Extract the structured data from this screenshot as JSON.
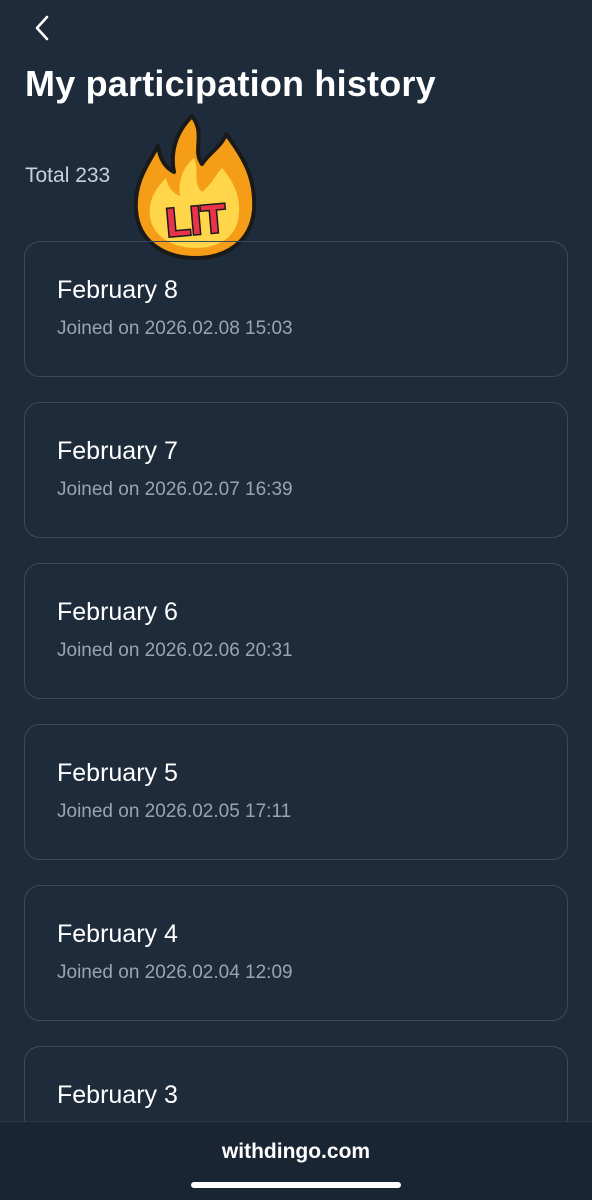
{
  "header": {
    "back_icon": "chevron-left-icon",
    "title": "My participation history"
  },
  "summary": {
    "total_text": "Total 233"
  },
  "sticker": {
    "text": "LIT",
    "icon": "fire-icon",
    "colors": {
      "flame_outer": "#f59d16",
      "flame_inner": "#ffd54a",
      "text_fill": "#e8334a",
      "outline": "#1a1a1a"
    }
  },
  "history": [
    {
      "date": "February 8",
      "joined": "Joined on 2026.02.08 15:03"
    },
    {
      "date": "February 7",
      "joined": "Joined on 2026.02.07 16:39"
    },
    {
      "date": "February 6",
      "joined": "Joined on 2026.02.06 20:31"
    },
    {
      "date": "February 5",
      "joined": "Joined on 2026.02.05 17:11"
    },
    {
      "date": "February 4",
      "joined": "Joined on 2026.02.04 12:09"
    },
    {
      "date": "February 3",
      "joined": ""
    }
  ],
  "footer": {
    "site": "withdingo.com"
  },
  "colors": {
    "background": "#1e2b3a",
    "card_border": "#3b4a5c",
    "title_text": "#ffffff",
    "secondary_text": "#9aa4b1"
  }
}
